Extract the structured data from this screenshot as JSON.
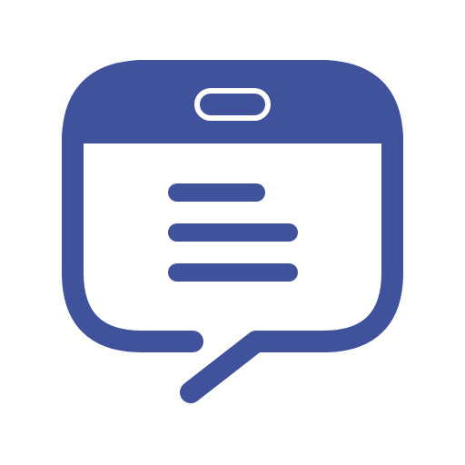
{
  "icon": {
    "name": "chat-bubble-document-icon",
    "primary_color": "#3F529B",
    "background_color": "#FFFFFF"
  }
}
